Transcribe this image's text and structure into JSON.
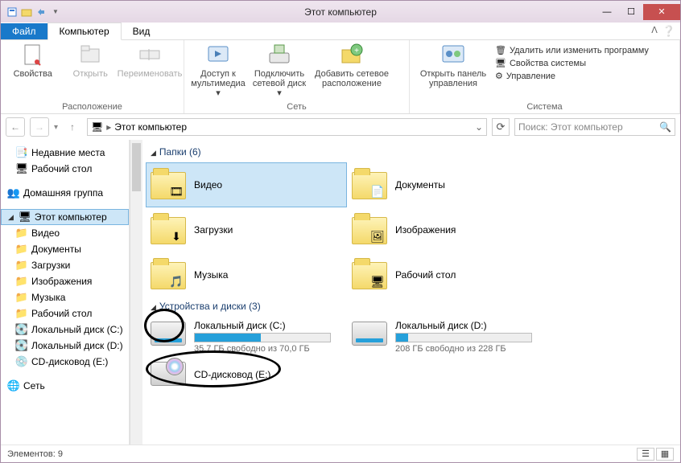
{
  "window": {
    "title": "Этот компьютер"
  },
  "tabs": {
    "file": "Файл",
    "computer": "Компьютер",
    "view": "Вид"
  },
  "ribbon": {
    "location": {
      "properties": "Свойства",
      "open": "Открыть",
      "rename": "Переименовать",
      "group": "Расположение"
    },
    "network": {
      "media": "Доступ к мультимедиа",
      "mapdrive": "Подключить сетевой диск",
      "addnet": "Добавить сетевое расположение",
      "group": "Сеть"
    },
    "system": {
      "cpl": "Открыть панель управления",
      "uninstall": "Удалить или изменить программу",
      "sysprops": "Свойства системы",
      "manage": "Управление",
      "group": "Система"
    }
  },
  "address": {
    "path": "Этот компьютер"
  },
  "search": {
    "placeholder": "Поиск: Этот компьютер"
  },
  "nav": {
    "recent": "Недавние места",
    "desktop": "Рабочий стол",
    "homegroup": "Домашняя группа",
    "thispc": "Этот компьютер",
    "videos": "Видео",
    "documents": "Документы",
    "downloads": "Загрузки",
    "pictures": "Изображения",
    "music": "Музыка",
    "desk2": "Рабочий стол",
    "localc": "Локальный диск (C:)",
    "locald": "Локальный диск (D:)",
    "cd": "CD-дисковод (E:)",
    "network": "Сеть"
  },
  "sections": {
    "folders": "Папки (6)",
    "devices": "Устройства и диски (3)"
  },
  "folders": {
    "video": "Видео",
    "documents": "Документы",
    "downloads": "Загрузки",
    "pictures": "Изображения",
    "music": "Музыка",
    "desktop": "Рабочий стол"
  },
  "drives": {
    "c": {
      "name": "Локальный диск (C:)",
      "free": "35,7 ГБ свободно из 70,0 ГБ",
      "pct": 49
    },
    "d": {
      "name": "Локальный диск (D:)",
      "free": "208 ГБ свободно из 228 ГБ",
      "pct": 9
    },
    "e": {
      "name": "CD-дисковод (E:)"
    }
  },
  "status": {
    "items": "Элементов: 9"
  }
}
